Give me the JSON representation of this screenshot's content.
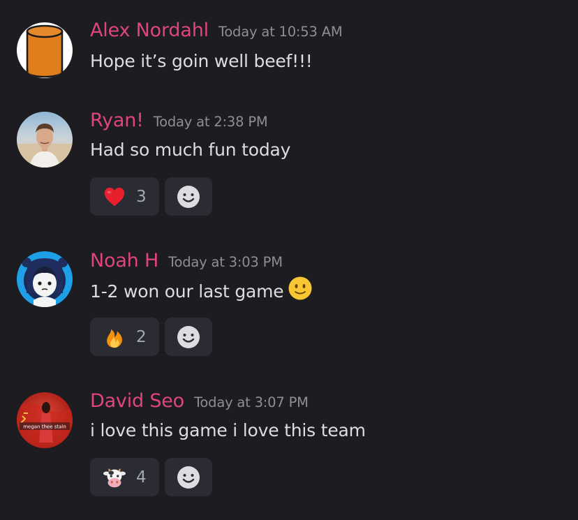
{
  "messages": [
    {
      "author": "Alex Nordahl",
      "time": "Today at 10:53 AM",
      "text": "Hope it’s goin well beef!!!",
      "avatar_icon": "orange-cylinder-icon",
      "reactions": []
    },
    {
      "author": "Ryan!",
      "time": "Today at 2:38 PM",
      "text": "Had so much fun today",
      "avatar_icon": "person-photo",
      "reactions": [
        {
          "emoji": "red-heart",
          "count": "3"
        }
      ]
    },
    {
      "author": "Noah H",
      "time": "Today at 3:03 PM",
      "text": "1-2 won our last game",
      "text_emoji": "slightly-smiling-face",
      "avatar_icon": "cartoon-character",
      "reactions": [
        {
          "emoji": "fire",
          "count": "2"
        }
      ]
    },
    {
      "author": "David Seo",
      "time": "Today at 3:07 PM",
      "text": "i love this game i love this team",
      "avatar_icon": "red-flag-photo",
      "avatar_caption": "megan thee stain",
      "reactions": [
        {
          "emoji": "cow-face",
          "count": "4"
        }
      ]
    }
  ],
  "colors": {
    "background": "#1c1c21",
    "author": "#e0457b",
    "timestamp": "#8d8e96",
    "message_text": "#dbdee1",
    "reaction_bg": "#2b2c33"
  }
}
